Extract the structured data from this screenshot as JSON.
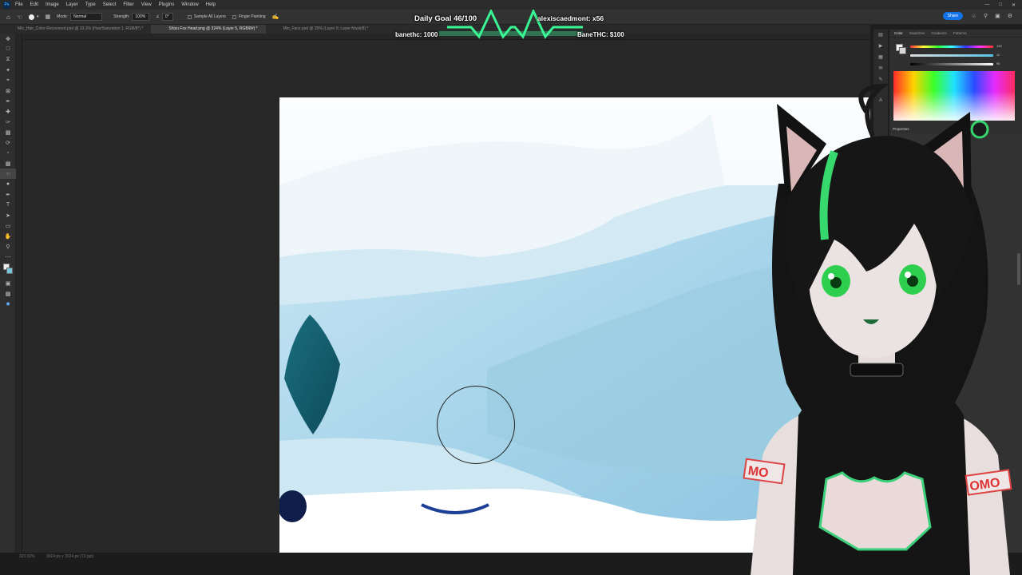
{
  "app": {
    "logo": "Ps",
    "menu": [
      "File",
      "Edit",
      "Image",
      "Layer",
      "Type",
      "Select",
      "Filter",
      "View",
      "Plugins",
      "Window",
      "Help"
    ],
    "share_label": "Share"
  },
  "options": {
    "mode_label": "Mode:",
    "mode_value": "Normal",
    "strength_label": "Strength:",
    "strength_value": "100%",
    "angle_value": "0°",
    "sample_all_layers": "Sample All Layers",
    "finger_painting": "Finger Painting"
  },
  "tabs": [
    {
      "label": "Mio_Hair_Color-Recovered.psd @ 33.3% (Hue/Saturation 1, RGB/8*) *",
      "active": false
    },
    {
      "label": "Shizu Fox Head.png @ 324% (Layer 5, RGB/8#) *",
      "active": true
    },
    {
      "label": "Mio_Face.psd @ 25% (Layer 9, Layer Mask/8) *",
      "active": false
    }
  ],
  "status": {
    "zoom": "323.92%",
    "doc_info": "3024 px x 3024 px (72 ppi)"
  },
  "color_panel": {
    "tabs": [
      "Color",
      "Swatches",
      "Gradients",
      "Patterns"
    ],
    "active_tab": "Color",
    "values": [
      "190",
      "11",
      "95"
    ],
    "properties_label": "Properties"
  },
  "stream_overlay": {
    "daily_goal": "Daily Goal 46/100",
    "recent_sub": "alexiscaedmont: x56",
    "left_counter": "banethc: 1000",
    "right_counter": "BaneTHC: $100",
    "accent_color": "#3cff9a"
  },
  "avatar": {
    "armband_left": "MO",
    "armband_right": "OMO"
  }
}
